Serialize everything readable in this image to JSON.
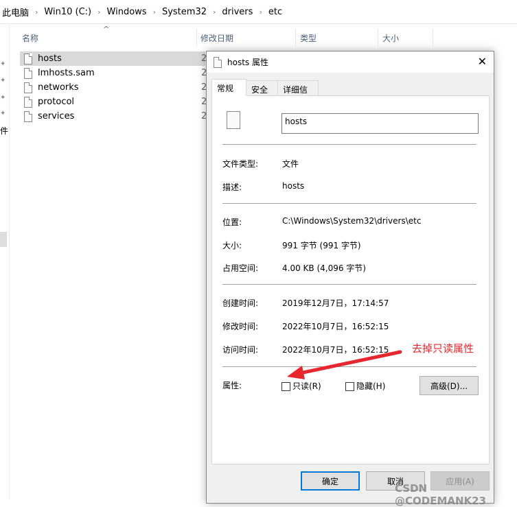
{
  "breadcrumb": [
    "此电脑",
    "Win10 (C:)",
    "Windows",
    "System32",
    "drivers",
    "etc"
  ],
  "columns": {
    "name": "名称",
    "modified": "修改日期",
    "type": "类型",
    "size": "大小"
  },
  "files": [
    {
      "name": "hosts",
      "date": "2"
    },
    {
      "name": "lmhosts.sam",
      "date": "2"
    },
    {
      "name": "networks",
      "date": "2"
    },
    {
      "name": "protocol",
      "date": "2"
    },
    {
      "name": "services",
      "date": "2"
    }
  ],
  "left_pane_label": "件",
  "dialog": {
    "title": "hosts 属性",
    "tabs": [
      "常规",
      "安全",
      "详细信息"
    ],
    "filename": "hosts",
    "fields": {
      "file_type": {
        "label": "文件类型:",
        "value": "文件"
      },
      "description": {
        "label": "描述:",
        "value": "hosts"
      },
      "location": {
        "label": "位置:",
        "value": "C:\\Windows\\System32\\drivers\\etc"
      },
      "size": {
        "label": "大小:",
        "value": "991 字节 (991 字节)"
      },
      "size_on_disk": {
        "label": "占用空间:",
        "value": "4.00 KB (4,096 字节)"
      },
      "created": {
        "label": "创建时间:",
        "value": "2019年12月7日，17:14:57"
      },
      "modified": {
        "label": "修改时间:",
        "value": "2022年10月7日，16:52:15"
      },
      "accessed": {
        "label": "访问时间:",
        "value": "2022年10月7日，16:52:15"
      }
    },
    "attributes_label": "属性:",
    "readonly": {
      "label": "只读(R)",
      "checked": false
    },
    "hidden": {
      "label": "隐藏(H)",
      "checked": false
    },
    "advanced": "高级(D)...",
    "ok": "确定",
    "cancel": "取消",
    "apply": "应用(A)"
  },
  "annotation": {
    "text": "去掉只读属性",
    "color": "#e8262d"
  },
  "watermark": "CSDN @CODEMANK23"
}
